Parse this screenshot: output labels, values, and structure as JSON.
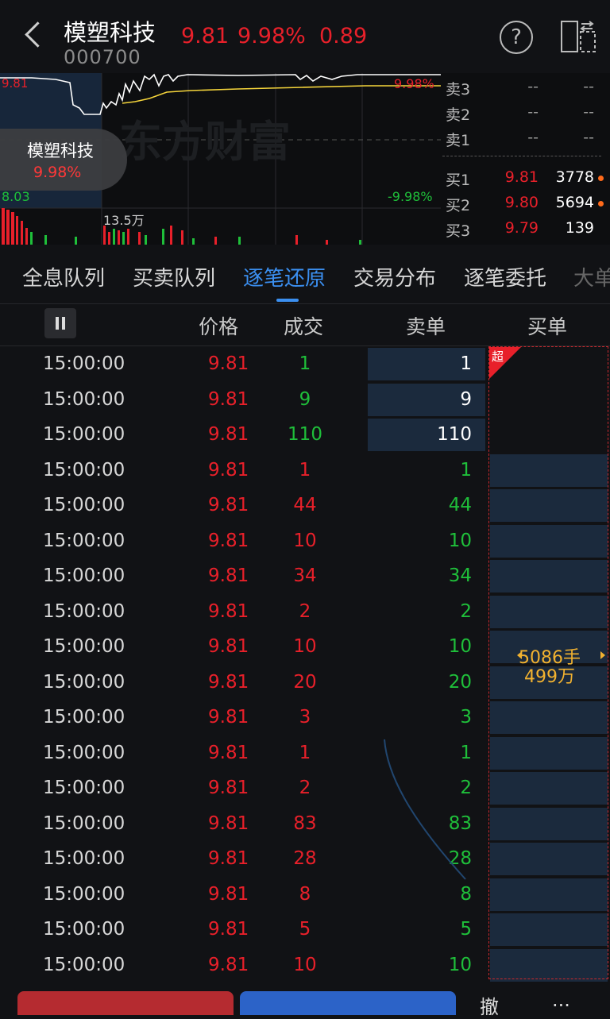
{
  "header": {
    "name": "模塑科技",
    "code": "000700",
    "price": "9.81",
    "change_pct": "9.98%",
    "change": "0.89",
    "help_icon": "?"
  },
  "chart": {
    "top_left_price": "9.81",
    "top_right_pct": "9.98%",
    "bottom_left_price": "8.03",
    "bottom_right_pct": "-9.98%",
    "volume_label": "13.5万",
    "watermark": "东方财富"
  },
  "badge": {
    "name": "模塑科技",
    "pct": "9.98%"
  },
  "orderbook": {
    "rows": [
      {
        "label": "卖3",
        "price": "--",
        "vol": "--"
      },
      {
        "label": "卖2",
        "price": "--",
        "vol": "--"
      },
      {
        "label": "卖1",
        "price": "--",
        "vol": "--"
      },
      {
        "label": "买1",
        "price": "9.81",
        "vol": "3778"
      },
      {
        "label": "买2",
        "price": "9.80",
        "vol": "5694"
      },
      {
        "label": "买3",
        "price": "9.79",
        "vol": "139"
      }
    ]
  },
  "tabs": [
    "全息队列",
    "买卖队列",
    "逐笔还原",
    "交易分布",
    "逐笔委托",
    "大单"
  ],
  "columns": {
    "price": "价格",
    "deal": "成交",
    "sell": "卖单",
    "buy": "买单"
  },
  "trades": [
    {
      "time": "15:00:00",
      "price": "9.81",
      "vol": "1",
      "sell": "1"
    },
    {
      "time": "15:00:00",
      "price": "9.81",
      "vol": "9",
      "sell": "9"
    },
    {
      "time": "15:00:00",
      "price": "9.81",
      "vol": "110",
      "sell": "110"
    },
    {
      "time": "15:00:00",
      "price": "9.81",
      "vol": "1",
      "sell": "1"
    },
    {
      "time": "15:00:00",
      "price": "9.81",
      "vol": "44",
      "sell": "44"
    },
    {
      "time": "15:00:00",
      "price": "9.81",
      "vol": "10",
      "sell": "10"
    },
    {
      "time": "15:00:00",
      "price": "9.81",
      "vol": "34",
      "sell": "34"
    },
    {
      "time": "15:00:00",
      "price": "9.81",
      "vol": "2",
      "sell": "2"
    },
    {
      "time": "15:00:00",
      "price": "9.81",
      "vol": "10",
      "sell": "10"
    },
    {
      "time": "15:00:00",
      "price": "9.81",
      "vol": "20",
      "sell": "20"
    },
    {
      "time": "15:00:00",
      "price": "9.81",
      "vol": "3",
      "sell": "3"
    },
    {
      "time": "15:00:00",
      "price": "9.81",
      "vol": "1",
      "sell": "1"
    },
    {
      "time": "15:00:00",
      "price": "9.81",
      "vol": "2",
      "sell": "2"
    },
    {
      "time": "15:00:00",
      "price": "9.81",
      "vol": "83",
      "sell": "83"
    },
    {
      "time": "15:00:00",
      "price": "9.81",
      "vol": "28",
      "sell": "28"
    },
    {
      "time": "15:00:00",
      "price": "9.81",
      "vol": "8",
      "sell": "8"
    },
    {
      "time": "15:00:00",
      "price": "9.81",
      "vol": "5",
      "sell": "5"
    },
    {
      "time": "15:00:00",
      "price": "9.81",
      "vol": "10",
      "sell": "10"
    }
  ],
  "buy_order": {
    "super_tag": "超",
    "lots": "5086手",
    "amount": "499万"
  },
  "bottom": {
    "cancel": "撤",
    "more": "..."
  },
  "colors": {
    "up": "#e8202a",
    "down": "#1fbf3a",
    "accent": "#3b8ff0",
    "highlight": "#f2b230"
  }
}
